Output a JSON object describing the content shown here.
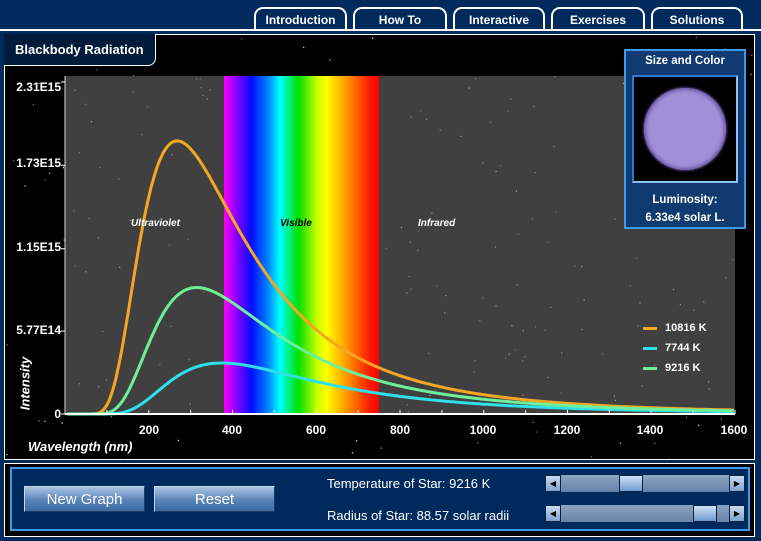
{
  "tabs": [
    {
      "label": "Introduction",
      "active": false
    },
    {
      "label": "How To",
      "active": false
    },
    {
      "label": "Interactive",
      "active": true
    },
    {
      "label": "Exercises",
      "active": false
    },
    {
      "label": "Solutions",
      "active": false
    }
  ],
  "panel_title": "Blackbody Radiation",
  "size_panel": {
    "title": "Size and Color",
    "star_color": "#a090d8",
    "luminosity_label": "Luminosity:",
    "luminosity_value": "6.33e4 solar L."
  },
  "regions": {
    "uv": "Ultraviolet",
    "visible": "Visible",
    "ir": "Infrared"
  },
  "controls": {
    "new_graph_label": "New Graph",
    "reset_label": "Reset",
    "temperature_label": "Temperature of Star: 9216 K",
    "radius_label": "Radius of Star: 88.57 solar radii",
    "temperature_slider_fraction": 0.4,
    "radius_slider_fraction": 0.92
  },
  "chart_data": {
    "type": "line",
    "title": "Blackbody Radiation",
    "xlabel": "Wavelength (nm)",
    "ylabel": "Intensity",
    "xlim": [
      0,
      1600
    ],
    "ylim": [
      0,
      2310000000000000.0
    ],
    "x_ticks": [
      200,
      400,
      600,
      800,
      1000,
      1200,
      1400,
      1600
    ],
    "y_ticks": [
      {
        "value": 0,
        "label": "0"
      },
      {
        "value": 577000000000000.0,
        "label": "5.77E14"
      },
      {
        "value": 1150000000000000.0,
        "label": "1.15E15"
      },
      {
        "value": 1730000000000000.0,
        "label": "1.73E15"
      },
      {
        "value": 2310000000000000.0,
        "label": "2.31E15"
      }
    ],
    "visible_band_nm": [
      380,
      750
    ],
    "legend_position": "right",
    "series": [
      {
        "name": "10816 K",
        "temperature": 10816,
        "color": "#f5a623",
        "peak_nm": 268,
        "peak_intensity": 1900000000000000.0
      },
      {
        "name": "7744 K",
        "temperature": 7744,
        "color": "#2ee0ea",
        "peak_nm": 374,
        "peak_intensity": 355000000000000.0
      },
      {
        "name": "9216 K",
        "temperature": 9216,
        "color": "#6ef09a",
        "peak_nm": 314,
        "peak_intensity": 880000000000000.0
      }
    ]
  }
}
